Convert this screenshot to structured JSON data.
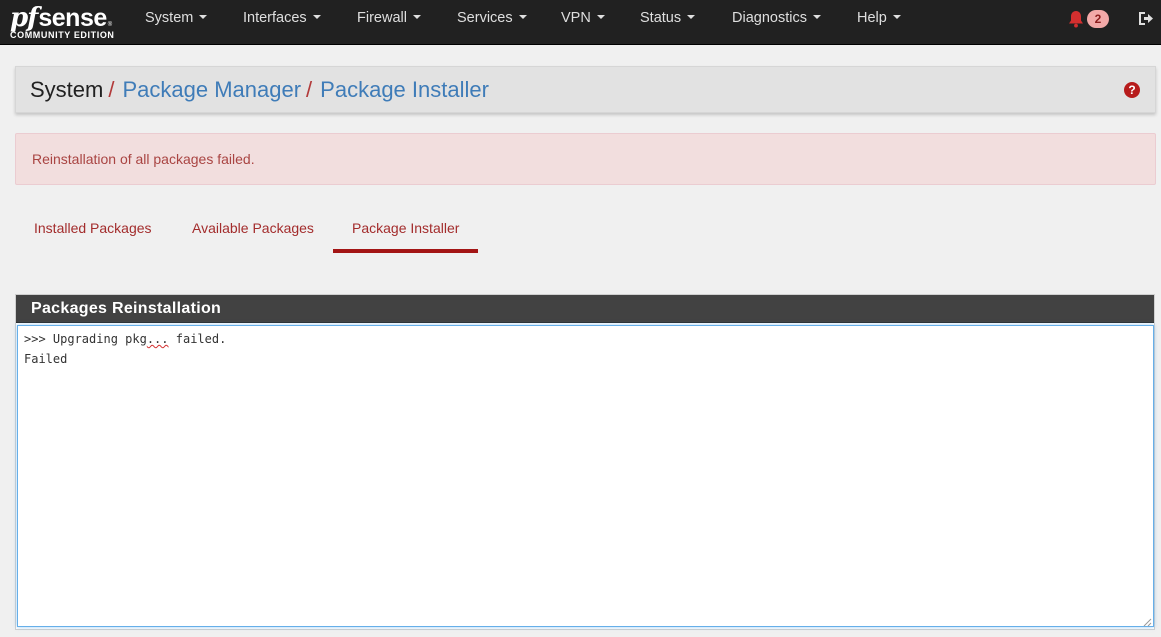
{
  "logo": {
    "brand_pf": "pf",
    "brand_sense": "sense",
    "edition": "COMMUNITY EDITION",
    "reg_mark": "®"
  },
  "nav": {
    "items": [
      {
        "label": "System"
      },
      {
        "label": "Interfaces"
      },
      {
        "label": "Firewall"
      },
      {
        "label": "Services"
      },
      {
        "label": "VPN"
      },
      {
        "label": "Status"
      },
      {
        "label": "Diagnostics"
      },
      {
        "label": "Help"
      }
    ],
    "notification_count": "2",
    "icons": {
      "notifications": "bell-icon",
      "logout": "logout-icon"
    }
  },
  "breadcrumb": {
    "root": "System",
    "separator": "/",
    "links": [
      "Package Manager",
      "Package Installer"
    ],
    "help_icon": "?"
  },
  "alert": {
    "message": "Reinstallation of all packages failed."
  },
  "tabs": [
    {
      "label": "Installed Packages",
      "active": false
    },
    {
      "label": "Available Packages",
      "active": false
    },
    {
      "label": "Package Installer",
      "active": true
    }
  ],
  "panel": {
    "title": "Packages Reinstallation",
    "console": {
      "line1_prefix": ">>> Upgrading pkg",
      "line1_misspelled": "...",
      "line1_suffix": " failed.",
      "line2": "Failed"
    }
  },
  "colors": {
    "navbar": "#212121",
    "accent_red": "#a31515",
    "link_blue": "#3f7cb8",
    "alert_bg": "#f2dede",
    "alert_text": "#a94442"
  }
}
